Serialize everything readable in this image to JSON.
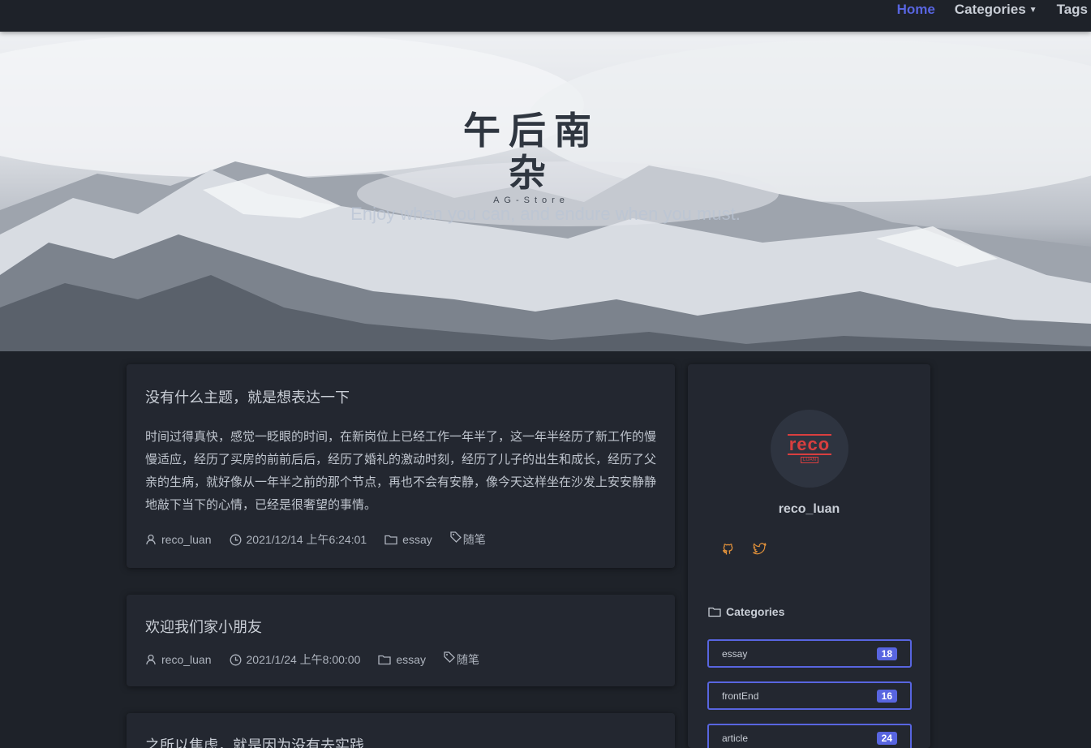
{
  "nav": {
    "items": [
      {
        "label": "Home",
        "active": true
      },
      {
        "label": "Categories",
        "dropdown": true
      },
      {
        "label": "Tags"
      }
    ]
  },
  "hero": {
    "logo_text": "午后南杂",
    "logo_subtext": "AG-Store",
    "tagline": "Enjoy when you can, and endure when you must."
  },
  "posts": [
    {
      "title": "没有什么主题，就是想表达一下",
      "excerpt": "时间过得真快，感觉一眨眼的时间，在新岗位上已经工作一年半了，这一年半经历了新工作的慢慢适应，经历了买房的前前后后，经历了婚礼的激动时刻，经历了儿子的出生和成长，经历了父亲的生病，就好像从一年半之前的那个节点，再也不会有安静，像今天这样坐在沙发上安安静静地敲下当下的心情，已经是很奢望的事情。",
      "author": "reco_luan",
      "date": "2021/12/14 上午6:24:01",
      "category": "essay",
      "tag": "随笔"
    },
    {
      "title": "欢迎我们家小朋友",
      "author": "reco_luan",
      "date": "2021/1/24 上午8:00:00",
      "category": "essay",
      "tag": "随笔"
    },
    {
      "title": "之所以焦虑，就是因为没有去实践"
    }
  ],
  "sidebar": {
    "avatar_text": "reco",
    "avatar_subtext": "LUAN",
    "author_name": "reco_luan",
    "social_icons": [
      "github-icon",
      "twitter-icon"
    ],
    "categories_heading": "Categories",
    "categories": [
      {
        "name": "essay",
        "count": "18"
      },
      {
        "name": "frontEnd",
        "count": "16"
      },
      {
        "name": "article",
        "count": "24"
      }
    ]
  },
  "colors": {
    "accent": "#5865e0",
    "background": "#1e2229",
    "card": "#232730",
    "social_icon": "#e0903a"
  }
}
